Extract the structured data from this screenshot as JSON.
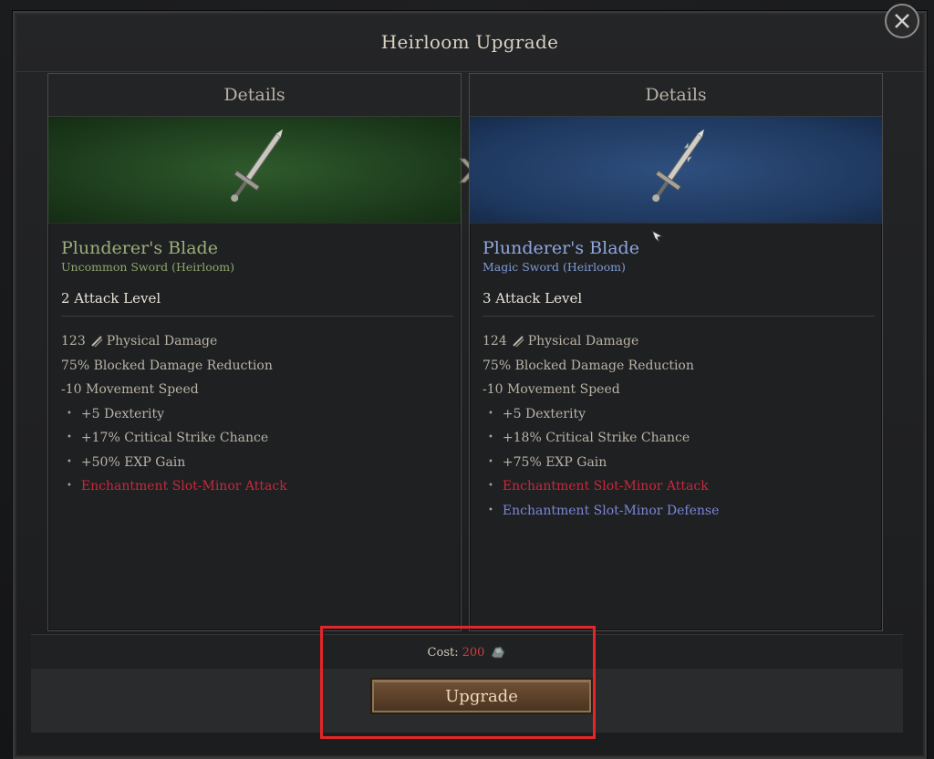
{
  "dialog": {
    "title": "Heirloom Upgrade"
  },
  "left": {
    "header": "Details",
    "item_name": "Plunderer's Blade",
    "item_sub": "Uncommon Sword (Heirloom)",
    "attack_level": "2 Attack Level",
    "stats": {
      "damage_value": "123",
      "damage_label": "Physical Damage",
      "line2": "75% Blocked Damage Reduction",
      "line3": "-10 Movement Speed"
    },
    "affixes": [
      "+5 Dexterity",
      "+17% Critical Strike Chance",
      "+50% EXP Gain"
    ],
    "enchant_slots": [
      "Enchantment Slot-Minor Attack"
    ],
    "rarity_color": "#9cae78",
    "art_color": "#2f5a2c"
  },
  "right": {
    "header": "Details",
    "item_name": "Plunderer's Blade",
    "item_sub": "Magic Sword (Heirloom)",
    "attack_level": "3 Attack Level",
    "stats": {
      "damage_value": "124",
      "damage_label": "Physical Damage",
      "line2": "75% Blocked Damage Reduction",
      "line3": "-10 Movement Speed"
    },
    "affixes": [
      "+5 Dexterity",
      "+18% Critical Strike Chance",
      "+75% EXP Gain"
    ],
    "enchant_slots": [
      "Enchantment Slot-Minor Attack",
      "Enchantment Slot-Minor Defense"
    ],
    "rarity_color": "#8fa7e0",
    "art_color": "#2e4f7e"
  },
  "cost": {
    "label": "Cost:",
    "value": "200",
    "icon": "ore-icon",
    "value_color": "#d23a3a"
  },
  "upgrade": {
    "label": "Upgrade"
  },
  "colors": {
    "highlight": "#e3262a",
    "enchant_attack": "#c8283b",
    "enchant_defense": "#7b86d8"
  }
}
